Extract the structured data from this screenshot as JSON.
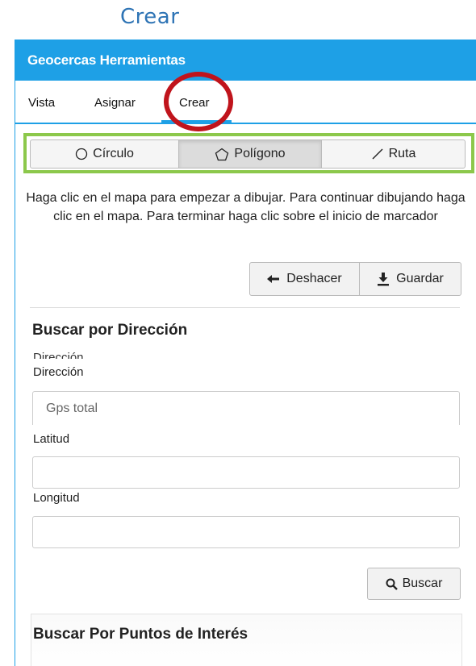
{
  "caption": "Crear",
  "panel": {
    "title": "Geocercas Herramientas",
    "accent_color": "#1ea0e6"
  },
  "tabs": [
    {
      "label": "Vista"
    },
    {
      "label": "Asignar"
    },
    {
      "label": "Crear",
      "active": true
    }
  ],
  "shapes": {
    "circulo": {
      "label": "Círculo",
      "icon": "circle-icon"
    },
    "poligono": {
      "label": "Polígono",
      "icon": "pentagon-icon",
      "selected": true
    },
    "ruta": {
      "label": "Ruta",
      "icon": "line-icon"
    }
  },
  "instructions": "Haga clic en el mapa para empezar a dibujar. Para continuar dibujando haga clic en el mapa. Para terminar haga clic sobre el inicio de marcador",
  "actions": {
    "deshacer": "Deshacer",
    "guardar": "Guardar"
  },
  "search_address": {
    "title": "Buscar por Dirección",
    "ghost_label": "Dirección",
    "direccion_label": "Dirección",
    "direccion_placeholder": "Gps total",
    "latitud_label": "Latitud",
    "latitud_value": "",
    "longitud_label": "Longitud",
    "longitud_value": "",
    "search_button": "Buscar"
  },
  "poi": {
    "title": "Buscar Por Puntos de Interés"
  },
  "annotations": {
    "highlight_circle_color": "#c0141c",
    "highlight_box_color": "#8cc84b"
  }
}
